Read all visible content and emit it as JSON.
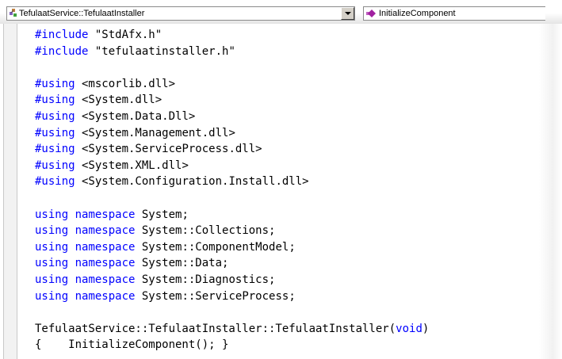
{
  "toolbar": {
    "class_combo": {
      "text": "TefulaatService::TefulaatInstaller",
      "icon": "class-icon"
    },
    "member_combo": {
      "text": "InitializeComponent",
      "icon": "method-icon"
    }
  },
  "colors": {
    "keyword": "#0000ff",
    "text": "#000000"
  },
  "code_lines": [
    [
      {
        "t": "#include",
        "k": 1
      },
      {
        "t": " \"StdAfx.h\"",
        "k": 0
      }
    ],
    [
      {
        "t": "#include",
        "k": 1
      },
      {
        "t": " \"tefulaatinstaller.h\"",
        "k": 0
      }
    ],
    [],
    [
      {
        "t": "#using",
        "k": 1
      },
      {
        "t": " <mscorlib.dll>",
        "k": 0
      }
    ],
    [
      {
        "t": "#using",
        "k": 1
      },
      {
        "t": " <System.dll>",
        "k": 0
      }
    ],
    [
      {
        "t": "#using",
        "k": 1
      },
      {
        "t": " <System.Data.Dll>",
        "k": 0
      }
    ],
    [
      {
        "t": "#using",
        "k": 1
      },
      {
        "t": " <System.Management.dll>",
        "k": 0
      }
    ],
    [
      {
        "t": "#using",
        "k": 1
      },
      {
        "t": " <System.ServiceProcess.dll>",
        "k": 0
      }
    ],
    [
      {
        "t": "#using",
        "k": 1
      },
      {
        "t": " <System.XML.dll>",
        "k": 0
      }
    ],
    [
      {
        "t": "#using",
        "k": 1
      },
      {
        "t": " <System.Configuration.Install.dll>",
        "k": 0
      }
    ],
    [],
    [
      {
        "t": "using",
        "k": 1
      },
      {
        "t": " ",
        "k": 0
      },
      {
        "t": "namespace",
        "k": 1
      },
      {
        "t": " System;",
        "k": 0
      }
    ],
    [
      {
        "t": "using",
        "k": 1
      },
      {
        "t": " ",
        "k": 0
      },
      {
        "t": "namespace",
        "k": 1
      },
      {
        "t": " System::Collections;",
        "k": 0
      }
    ],
    [
      {
        "t": "using",
        "k": 1
      },
      {
        "t": " ",
        "k": 0
      },
      {
        "t": "namespace",
        "k": 1
      },
      {
        "t": " System::ComponentModel;",
        "k": 0
      }
    ],
    [
      {
        "t": "using",
        "k": 1
      },
      {
        "t": " ",
        "k": 0
      },
      {
        "t": "namespace",
        "k": 1
      },
      {
        "t": " System::Data;",
        "k": 0
      }
    ],
    [
      {
        "t": "using",
        "k": 1
      },
      {
        "t": " ",
        "k": 0
      },
      {
        "t": "namespace",
        "k": 1
      },
      {
        "t": " System::Diagnostics;",
        "k": 0
      }
    ],
    [
      {
        "t": "using",
        "k": 1
      },
      {
        "t": " ",
        "k": 0
      },
      {
        "t": "namespace",
        "k": 1
      },
      {
        "t": " System::ServiceProcess;",
        "k": 0
      }
    ],
    [],
    [
      {
        "t": "TefulaatService::TefulaatInstaller::TefulaatInstaller(",
        "k": 0
      },
      {
        "t": "void",
        "k": 1
      },
      {
        "t": ")",
        "k": 0
      }
    ],
    [
      {
        "t": "{    InitializeComponent(); }",
        "k": 0
      }
    ]
  ]
}
